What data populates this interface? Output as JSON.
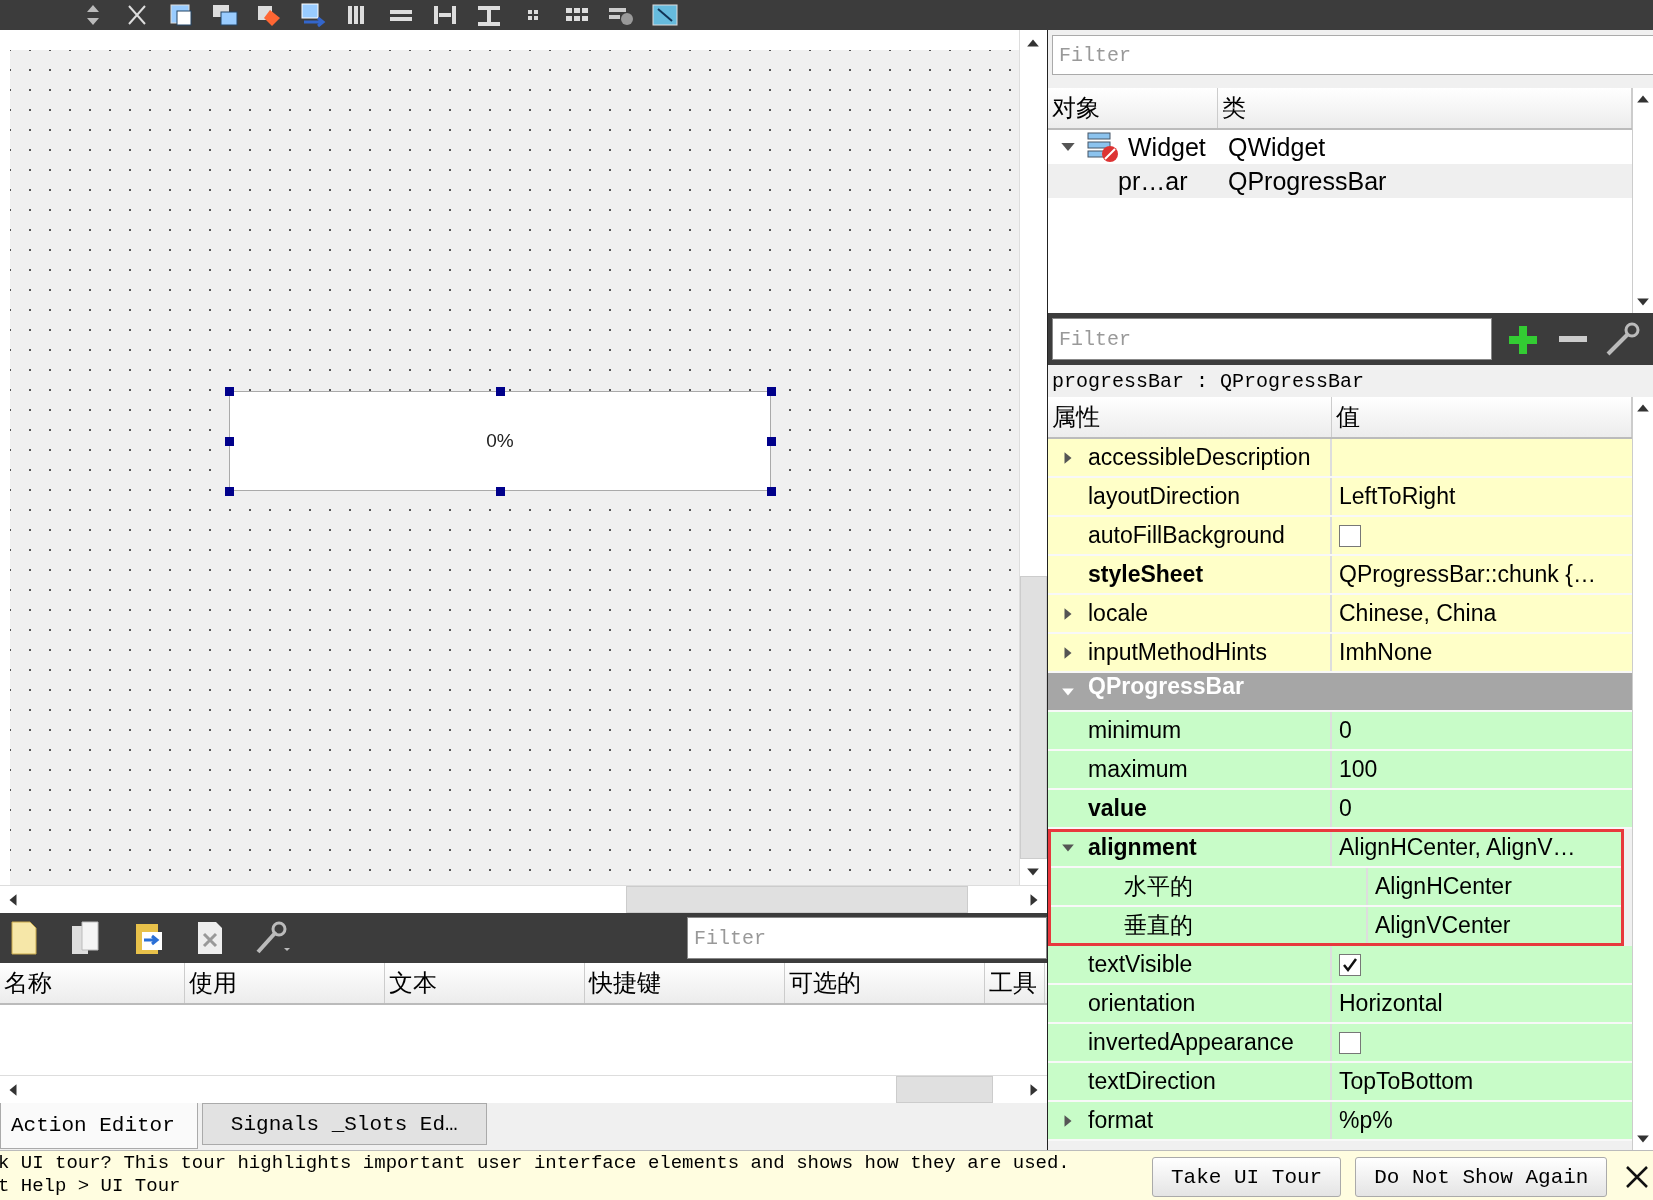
{
  "canvas": {
    "progress_bar": {
      "text": "0%",
      "level": 0
    }
  },
  "object_inspector": {
    "filter": {
      "placeholder": "Filter"
    },
    "columns": [
      "对象",
      "类"
    ],
    "tree": [
      {
        "name": "Widget",
        "class": "QWidget",
        "expanded": true,
        "children": [
          {
            "name": "pr…ar",
            "class": "QProgressBar"
          }
        ]
      }
    ]
  },
  "property_editor": {
    "filter": {
      "placeholder": "Filter"
    },
    "object_label": "progressBar : QProgressBar",
    "columns": [
      "属性",
      "值"
    ],
    "rows": [
      {
        "kind": "text",
        "name": "accessibleDescription",
        "color": "#ffffc8",
        "expanded": false
      },
      {
        "kind": "text",
        "name": "layoutDirection",
        "value": "LeftToRight",
        "color": "#ffffc8"
      },
      {
        "kind": "checkbox",
        "name": "autoFillBackground",
        "checked": false,
        "color": "#ffffc8"
      },
      {
        "kind": "text",
        "name": "styleSheet",
        "value": "QProgressBar::chunk {…",
        "bold": true,
        "color": "#ffffc8"
      },
      {
        "kind": "text",
        "name": "locale",
        "value": "Chinese, China",
        "color": "#ffffc8",
        "expanded": false
      },
      {
        "kind": "text",
        "name": "inputMethodHints",
        "value": "ImhNone",
        "color": "#ffffc8",
        "expanded": false
      },
      {
        "kind": "section",
        "name": "QProgressBar",
        "expanded": true
      },
      {
        "kind": "text",
        "name": "minimum",
        "value": "0",
        "color": "#c8fcc8"
      },
      {
        "kind": "text",
        "name": "maximum",
        "value": "100",
        "color": "#c8fcc8"
      },
      {
        "kind": "text",
        "name": "value",
        "value": "0",
        "bold": true,
        "color": "#c8fcc8"
      },
      {
        "kind": "text",
        "name": "alignment",
        "value": "AlignHCenter, AlignV…",
        "bold": true,
        "color": "#c8fcc8",
        "expanded": true,
        "highlighted": true,
        "children": [
          {
            "kind": "text",
            "name": "水平的",
            "value": "AlignHCenter",
            "color": "#c8fcc8"
          },
          {
            "kind": "text",
            "name": "垂直的",
            "value": "AlignVCenter",
            "color": "#c8fcc8"
          }
        ]
      },
      {
        "kind": "checkbox",
        "name": "textVisible",
        "checked": true,
        "color": "#c8fcc8"
      },
      {
        "kind": "text",
        "name": "orientation",
        "value": "Horizontal",
        "color": "#c8fcc8"
      },
      {
        "kind": "checkbox",
        "name": "invertedAppearance",
        "checked": false,
        "color": "#c8fcc8"
      },
      {
        "kind": "text",
        "name": "textDirection",
        "value": "TopToBottom",
        "color": "#c8fcc8"
      },
      {
        "kind": "text",
        "name": "format",
        "value": "%p%",
        "color": "#c8fcc8",
        "expanded": false
      }
    ]
  },
  "action_editor": {
    "filter": {
      "placeholder": "Filter"
    },
    "columns": [
      "名称",
      "使用",
      "文本",
      "快捷键",
      "可选的",
      "工具"
    ]
  },
  "tabs": [
    {
      "label": "Action Editor",
      "selected": true
    },
    {
      "label": "Signals _Slots Ed…",
      "selected": false
    }
  ],
  "tour_bar": {
    "lines": [
      "k UI tour? This tour highlights important user interface elements and shows how they are used.",
      "t Help > UI Tour"
    ],
    "buttons": [
      "Take UI Tour",
      "Do Not Show Again"
    ]
  }
}
